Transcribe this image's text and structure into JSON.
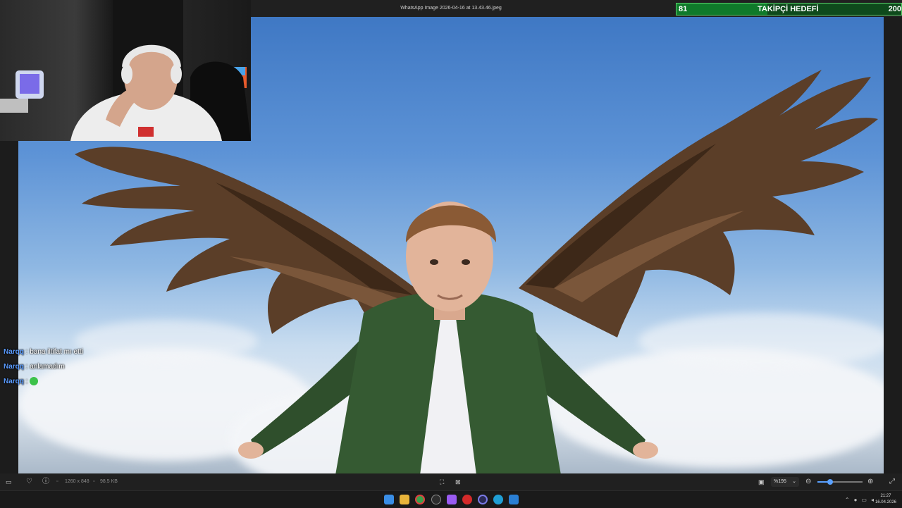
{
  "window": {
    "title": "WhatsApp Image 2026-04-16 at 13.43.46.jpeg",
    "controls": {
      "minimize": "─",
      "maximize": "▢",
      "close": "✕"
    }
  },
  "goal": {
    "current": "81",
    "label": "TAKİPÇİ HEDEFİ",
    "target": "200",
    "progress": 0.405,
    "colors": {
      "background": "#0e4a1c",
      "fill": "#0f7a2a",
      "border": "#5ad16b"
    }
  },
  "chat": {
    "messages": [
      {
        "user": "Narqq",
        "sep": " : ",
        "text": "bana iltifat mı etti"
      },
      {
        "user": "Narqq",
        "sep": " : ",
        "text": "anlamadım"
      },
      {
        "user": "Narqq",
        "sep": " : ",
        "text": ""
      }
    ],
    "user_color": "#5b9cff"
  },
  "toolbar": {
    "dimensions": "1260 x 848",
    "filesize": "98.5 KB",
    "zoom": "%195",
    "zoom_slider_value": 0.28
  },
  "taskbar": {
    "time": "21:27",
    "date": "16.04.2026"
  },
  "icons": {
    "heart": "heart-icon",
    "info": "info-icon",
    "fit": "fit-to-screen-icon",
    "actual": "actual-size-icon",
    "zoom_out": "zoom-out-icon",
    "zoom_in": "zoom-in-icon",
    "fullscreen": "fullscreen-icon"
  }
}
